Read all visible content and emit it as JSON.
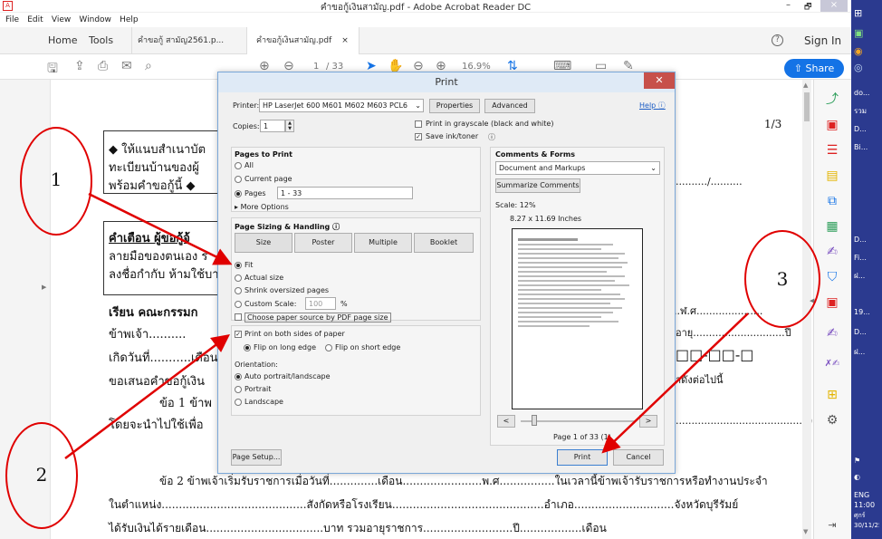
{
  "window": {
    "title": "คำขอกู้เงินสามัญ.pdf - Adobe Acrobat Reader DC",
    "min": "–",
    "restore": "🗗",
    "close": "×"
  },
  "menu": [
    "File",
    "Edit",
    "View",
    "Window",
    "Help"
  ],
  "tabs": {
    "home": "Home",
    "tools": "Tools",
    "doc1": "คำขอกู้ สามัญ2561.p...",
    "doc2": "คำขอกู้เงินสามัญ.pdf",
    "signin": "Sign In"
  },
  "toolbar": {
    "page": "1",
    "of": "/ 33",
    "zoom": "16.9%",
    "share": "Share"
  },
  "document": {
    "pagenum": "1/3",
    "l1": "◆ ให้แนบสำเนาบัต",
    "l2": "ทะเบียนบ้านของผู้",
    "l3": "พร้อมคำขอกู้นี้ ◆",
    "l4": "คำเตือน  ผู้ขอกู้จ้",
    "l5": "ลายมือของตนเอง ร",
    "l6": "ลงชื่อกำกับ ห้ามใช้บา",
    "l7": "เรียน  คณะกรรมก",
    "l8": "ข้าพเจ้า..........",
    "l9": "เกิดวันที่...........เดือน",
    "l10": "ขอเสนอคำขอกู้เงิน",
    "l11": "ข้อ 1  ข้าพ",
    "l12": "โดยจะนำไปใช้เพื่อ",
    "l13": "ข้อ 2 ข้าพเจ้าเริ่มรับราชการเมื่อวันที่..............เดือน.......................พ.ศ................ในเวลานี้ข้าพเจ้ารับราชการหรือทำงานประจำ",
    "l14": "ในตำแหน่ง..........................................สังกัดหรือโรงเรียน............................................อำเภอ.............................จังหวัดบุรีรัมย์",
    "l15": "ได้รับเงินได้รายเดือน..................................บาท รวมอายุราชการ..........................ปี..................เดือน",
    "r1": "........../..........",
    "r2": "..ฬ.ศ.....................",
    "r3": "อายุ.............................ปี",
    "r4": "□□-□□-□",
    "r5": "าดังต่อไปนี้",
    "r6": "..........................................)"
  },
  "dialog": {
    "title": "Print",
    "close": "✕",
    "printer_label": "Printer:",
    "printer": "HP LaserJet 600 M601 M602 M603 PCL6",
    "properties": "Properties",
    "advanced": "Advanced",
    "help": "Help ⓘ",
    "copies_label": "Copies:",
    "copies": "1",
    "grayscale": "Print in grayscale (black and white)",
    "save_ink": "Save ink/toner",
    "pages_to_print": "Pages to Print",
    "all": "All",
    "current_page": "Current page",
    "pages": "Pages",
    "pages_value": "1 - 33",
    "more_options": "More Options",
    "sizing": "Page Sizing & Handling ⓘ",
    "size": "Size",
    "poster": "Poster",
    "multiple": "Multiple",
    "booklet": "Booklet",
    "fit": "Fit",
    "actual_size": "Actual size",
    "shrink": "Shrink oversized pages",
    "custom_scale": "Custom Scale:",
    "custom_value": "100",
    "percent": "%",
    "paper_source": "Choose paper source by PDF page size",
    "both_sides": "Print on both sides of paper",
    "flip_long": "Flip on long edge",
    "flip_short": "Flip on short edge",
    "orientation": "Orientation:",
    "auto": "Auto portrait/landscape",
    "portrait": "Portrait",
    "landscape": "Landscape",
    "comments_forms": "Comments & Forms",
    "doc_markups": "Document and Markups",
    "summarize": "Summarize Comments",
    "scale": "Scale: 12%",
    "paper_size": "8.27 x 11.69 Inches",
    "page_of": "Page 1 of 33 (1)",
    "page_setup": "Page Setup...",
    "print": "Print",
    "cancel": "Cancel"
  },
  "annotations": {
    "c1": "1",
    "c2": "2",
    "c3": "3"
  },
  "taskbar": {
    "i1": "do...",
    "i2": "รวม",
    "i3": "D...",
    "i4": "Bi...",
    "i5": "D...",
    "i6": "Fi...",
    "i7": "ฝ...",
    "i8": "19...",
    "i9": "D...",
    "i10": "ฝ...",
    "lang": "ENG",
    "time": "11:00",
    "day": "ศุกร์",
    "date": "30/11/25"
  }
}
